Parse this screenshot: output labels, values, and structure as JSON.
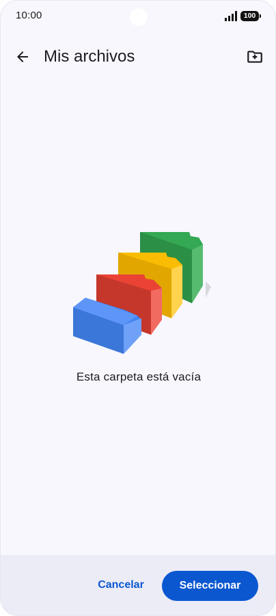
{
  "status_bar": {
    "time": "10:00",
    "battery": "100",
    "signal_icon": "signal-bars-icon"
  },
  "app_bar": {
    "back_icon": "arrow-back-icon",
    "title": "Mis archivos",
    "new_folder_icon": "create-new-folder-icon"
  },
  "empty_state": {
    "illustration": "empty-folders-illustration",
    "message": "Esta carpeta está vacía"
  },
  "actions": {
    "cancel_label": "Cancelar",
    "select_label": "Seleccionar"
  },
  "colors": {
    "accent": "#0b57d0",
    "background": "#f7f7fd",
    "bottom_bar": "#ececf6",
    "folder_blue": "#4285f4",
    "folder_red": "#ea4335",
    "folder_yellow": "#fbbc04",
    "folder_green": "#34a853"
  }
}
